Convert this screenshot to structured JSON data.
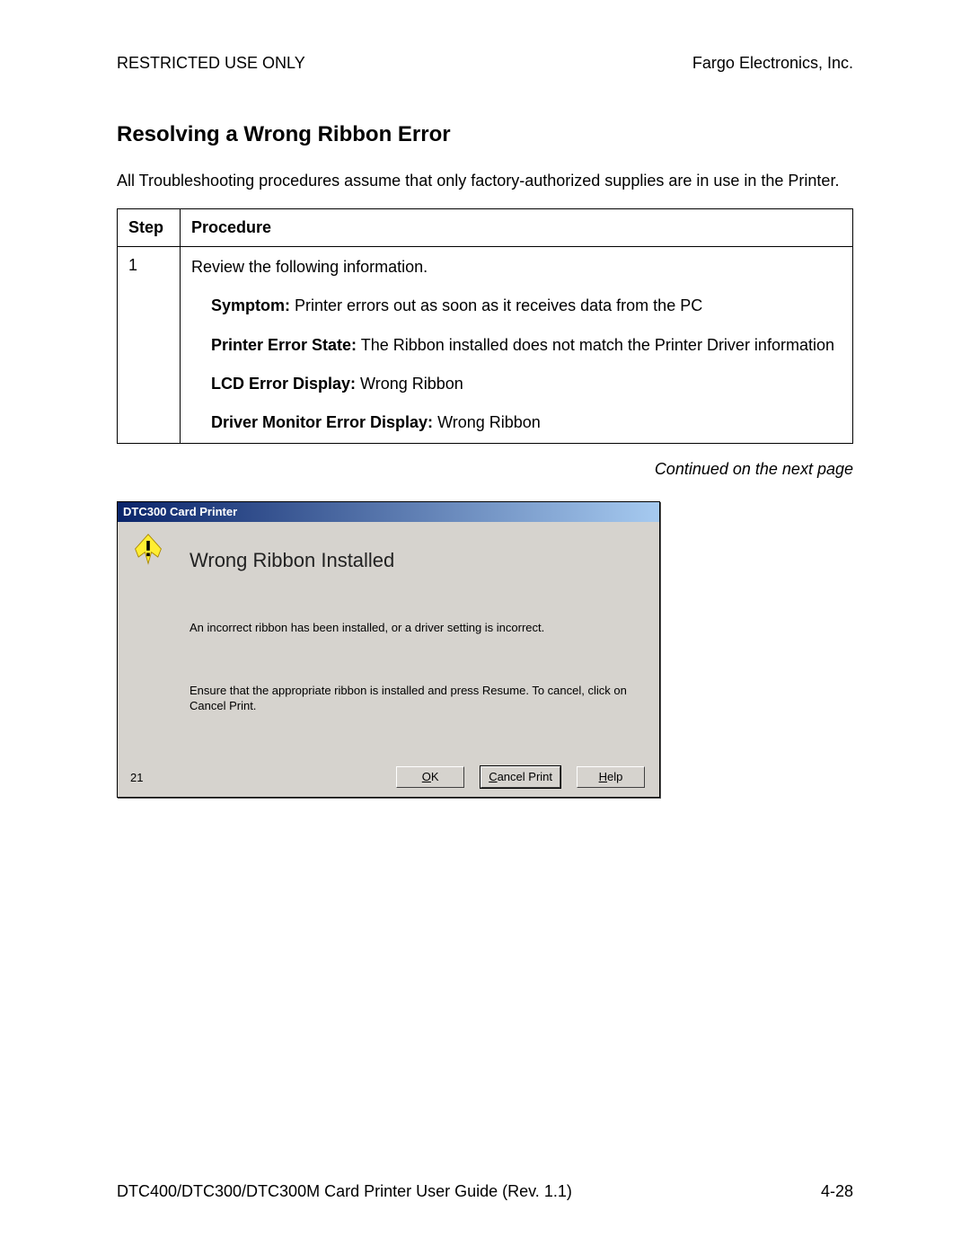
{
  "header": {
    "left": "RESTRICTED USE ONLY",
    "right": "Fargo Electronics, Inc."
  },
  "title": "Resolving a Wrong Ribbon Error",
  "intro": "All Troubleshooting procedures assume that only factory-authorized supplies are in use in the Printer.",
  "table": {
    "headers": {
      "step": "Step",
      "procedure": "Procedure"
    },
    "row": {
      "step": "1",
      "line1": "Review the following information.",
      "symptom_label": "Symptom:",
      "symptom_text": "  Printer errors out as soon as it receives data from the PC",
      "state_label": "Printer Error State:",
      "state_text": "  The Ribbon installed does not match the Printer Driver information",
      "lcd_label": "LCD Error Display:",
      "lcd_text": "  Wrong Ribbon",
      "driver_label": "Driver Monitor Error Display:",
      "driver_text": "  Wrong Ribbon"
    }
  },
  "continued": "Continued on the next page",
  "dialog": {
    "title": "DTC300 Card Printer",
    "heading": "Wrong Ribbon Installed",
    "line1": "An incorrect ribbon has been installed, or a driver setting is incorrect.",
    "line2": "Ensure that the appropriate ribbon is installed and press Resume. To cancel, click on Cancel Print.",
    "count": "21",
    "buttons": {
      "ok_u": "O",
      "ok_rest": "K",
      "cancel_u": "C",
      "cancel_rest": "ancel Print",
      "help_u": "H",
      "help_rest": "elp"
    }
  },
  "footer": {
    "left": "DTC400/DTC300/DTC300M Card Printer User Guide (Rev. 1.1)",
    "right": "4-28"
  }
}
